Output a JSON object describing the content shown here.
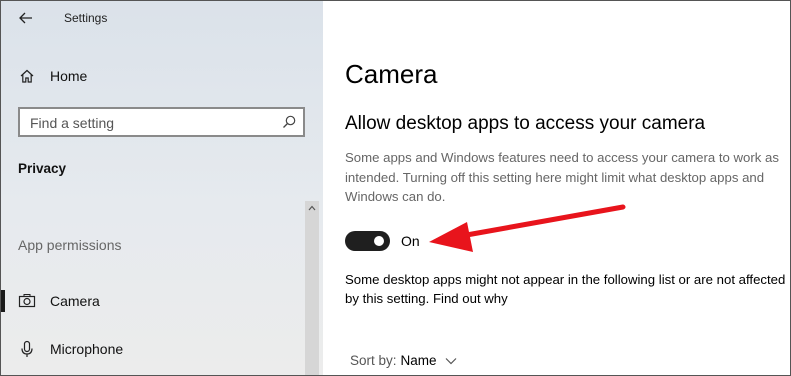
{
  "window": {
    "title": "Settings"
  },
  "sidebar": {
    "home_label": "Home",
    "search_placeholder": "Find a setting",
    "section_title": "Privacy",
    "group_title": "App permissions",
    "items": [
      {
        "label": "Camera",
        "icon": "camera-icon",
        "active": true
      },
      {
        "label": "Microphone",
        "icon": "microphone-icon",
        "active": false
      }
    ]
  },
  "main": {
    "title": "Camera",
    "subheading": "Allow desktop apps to access your camera",
    "description": "Some apps and Windows features need to access your camera to work as intended. Turning off this setting here might limit what desktop apps and Windows can do.",
    "toggle_state": "On",
    "note": "Some desktop apps might not appear in the following list or are not affected by this setting. Find out why",
    "sort_label": "Sort by:",
    "sort_value": "Name"
  },
  "annotation": {
    "arrow_color": "#e8141c"
  },
  "colors": {
    "toggle_on": "#1f1f1f",
    "sidebar_bg": "#e3e8ed"
  }
}
